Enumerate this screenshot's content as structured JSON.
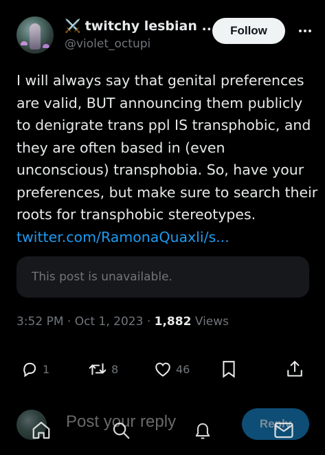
{
  "author": {
    "display_name": "twitchy lesbian ...",
    "display_emoji": "⚔️",
    "handle": "@violet_octupi"
  },
  "follow_label": "Follow",
  "post": {
    "text": "I will always say that genital preferences are valid, BUT announcing them publicly to denigrate trans ppl IS transphobic, and they are often based in (even unconscious) transphobia. So, have your preferences, but make sure to search their roots for transphobic stereotypes.",
    "link": "twitter.com/RamonaQuaxli/s..."
  },
  "quote": {
    "text": "This post is unavailable."
  },
  "meta": {
    "time": "3:52 PM",
    "date": "Oct 1, 2023",
    "views_count": "1,882",
    "views_label": "Views"
  },
  "actions": {
    "replies": "1",
    "reposts": "8",
    "likes": "46"
  },
  "reply_bar": {
    "placeholder": "Post your reply",
    "button_label": "Reply"
  },
  "icons": {
    "more": "more-dots-icon",
    "reply": "reply-bubble-icon",
    "repost": "repost-icon",
    "like": "heart-icon",
    "bookmark": "bookmark-icon",
    "share": "share-icon",
    "home": "home-icon",
    "search": "search-icon",
    "notifications": "bell-icon",
    "messages": "envelope-icon"
  },
  "colors": {
    "background": "#000000",
    "text": "#e7e9ea",
    "muted": "#71767b",
    "link": "#1d9bf0",
    "follow_bg": "#eff3f4",
    "reply_btn_bg": "#0e4d75"
  }
}
